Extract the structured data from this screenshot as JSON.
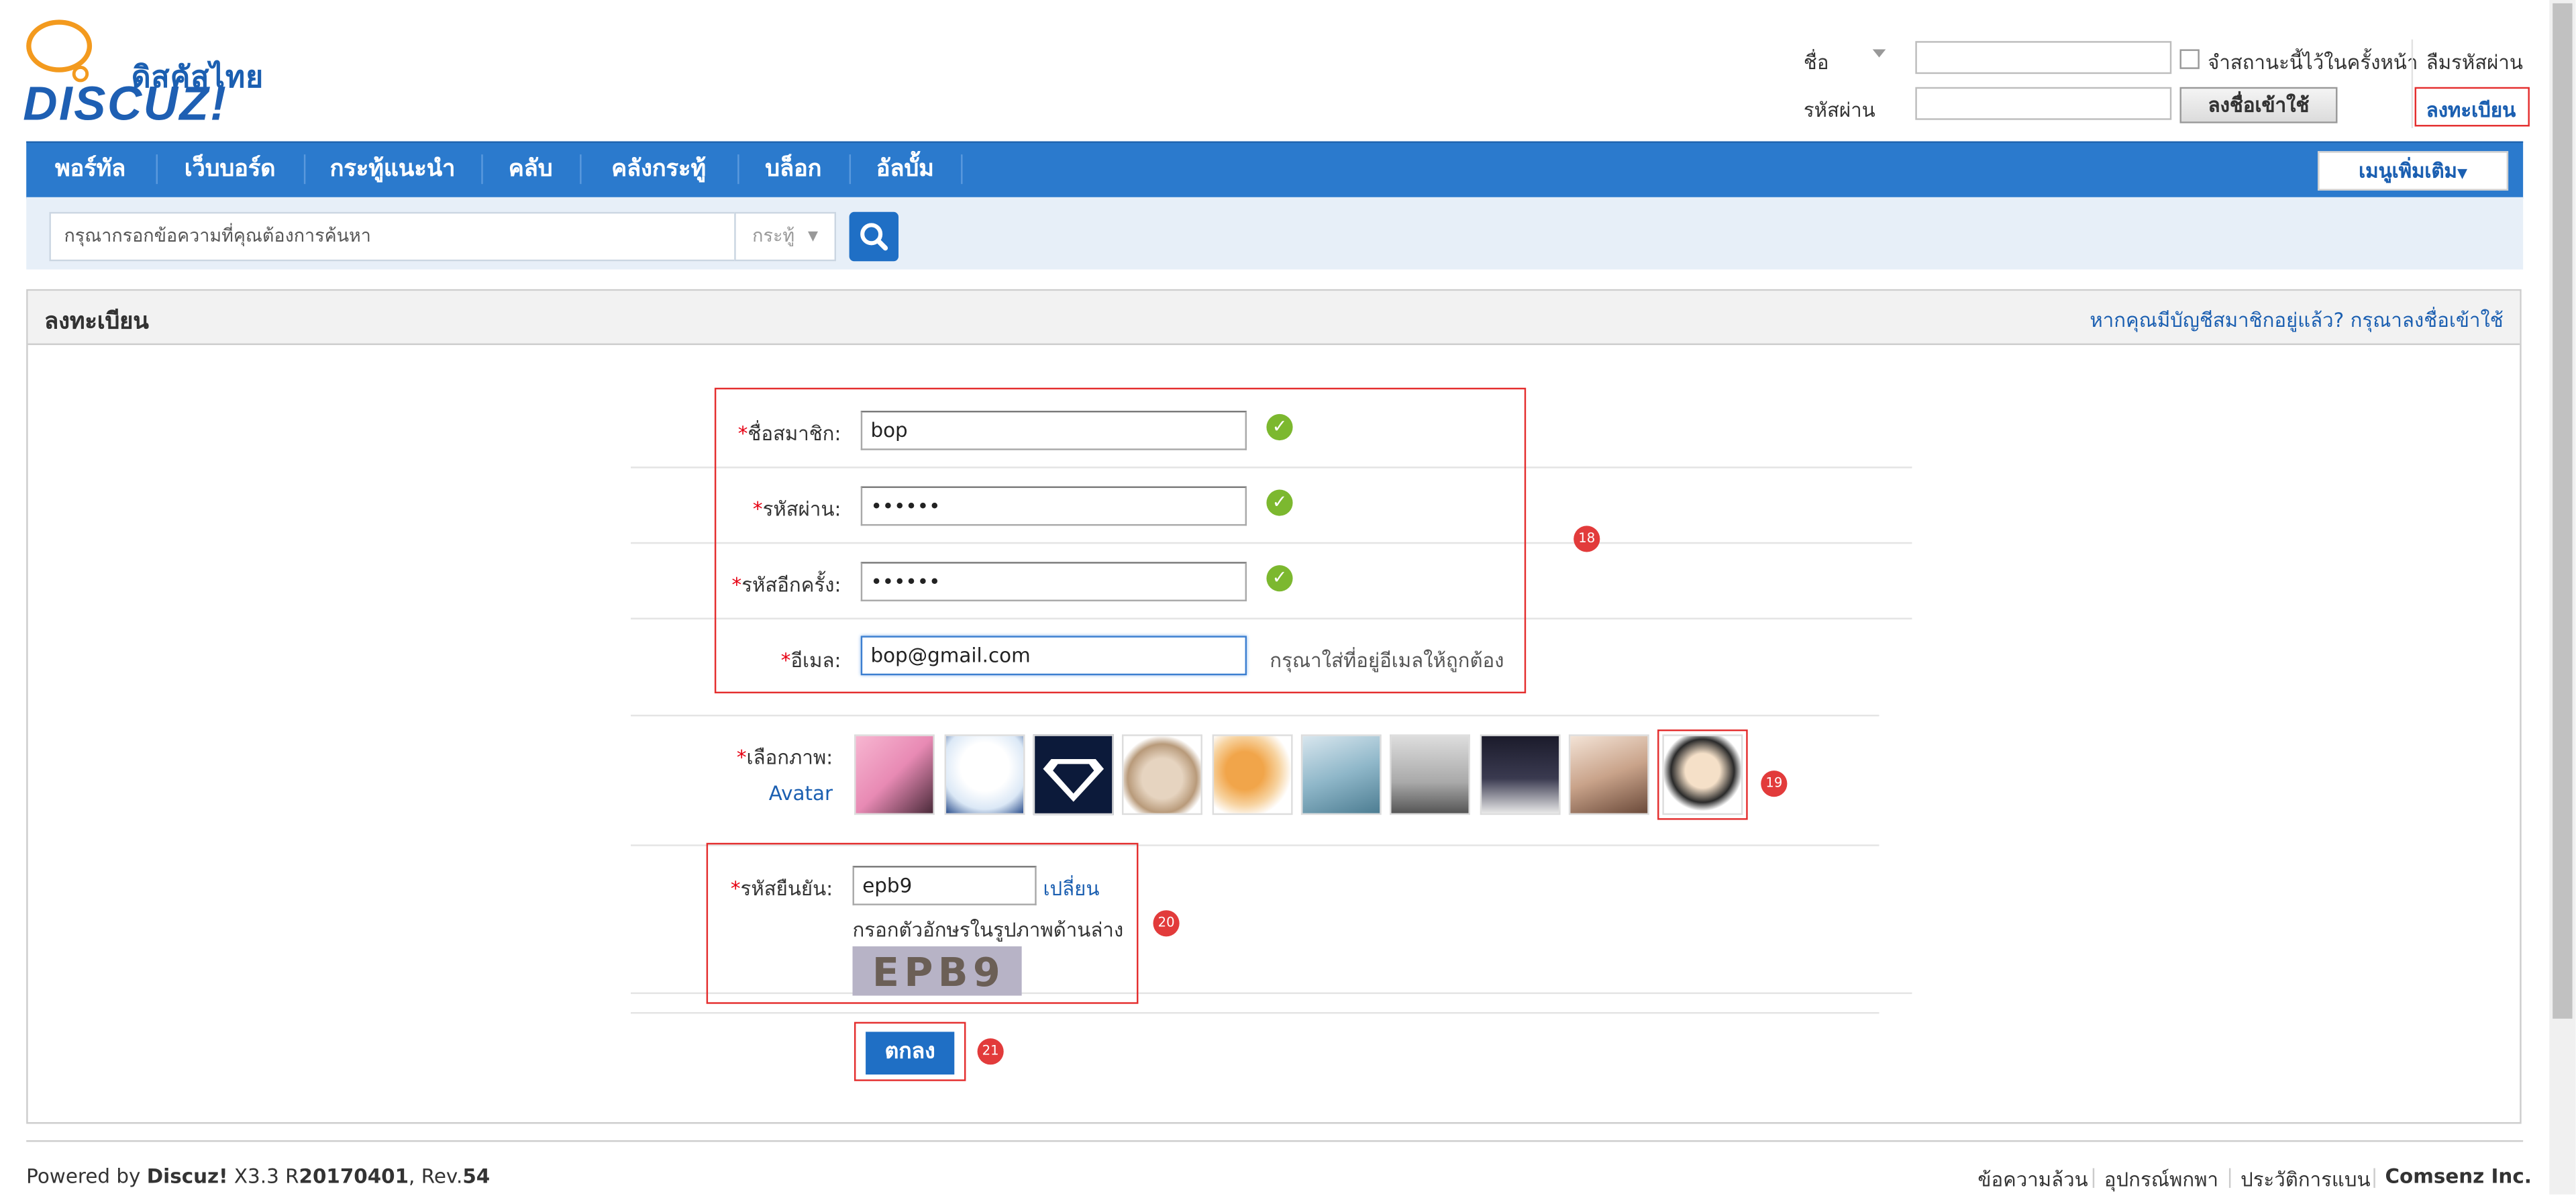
{
  "header": {
    "logo_thai": "ดิสคัสไทย",
    "logo_en": "DISCUZ!",
    "login": {
      "username_label": "ชื่อ",
      "password_label": "รหัสผ่าน",
      "remember_label": "จำสถานะนี้ไว้ในครั้งหน้า",
      "forgot_password": "ลืมรหัสผ่าน",
      "login_button": "ลงชื่อเข้าใช้",
      "register_link": "ลงทะเบียน"
    }
  },
  "nav": {
    "items": [
      "พอร์ทัล",
      "เว็บบอร์ด",
      "กระทู้แนะนำ",
      "คลับ",
      "คลังกระทู้",
      "บล็อก",
      "อัลบั้ม"
    ],
    "more": "เมนูเพิ่มเติม"
  },
  "search": {
    "placeholder": "กรุณากรอกข้อความที่คุณต้องการค้นหา",
    "type": "กระทู้"
  },
  "register": {
    "title": "ลงทะเบียน",
    "login_prompt": "หากคุณมีบัญชีสมาชิกอยู่แล้ว? กรุณาลงชื่อเข้าใช้",
    "fields": {
      "username": {
        "label": "ชื่อสมาชิก:",
        "value": "bop"
      },
      "password": {
        "label": "รหัสผ่าน:",
        "value": "••••••"
      },
      "password2": {
        "label": "รหัสอีกครั้ง:",
        "value": "••••••"
      },
      "email": {
        "label": "อีเมล:",
        "value": "bop@gmail.com",
        "hint": "กรุณาใส่ที่อยู่อีเมลให้ถูกต้อง"
      }
    },
    "avatar": {
      "label": "เลือกภาพ:",
      "sub": "Avatar"
    },
    "captcha": {
      "label": "รหัสยืนยัน:",
      "value": "epb9",
      "change": "เปลี่ยน",
      "hint": "กรอกตัวอักษรในรูปภาพด้านล่าง",
      "image_text": "EPB9"
    },
    "submit": "ตกลง",
    "required_mark": "*"
  },
  "annotations": [
    "18",
    "19",
    "20",
    "21"
  ],
  "footer": {
    "powered_prefix": "Powered by ",
    "brand": "Discuz!",
    "version": " X3.3 R",
    "rev_date": "20170401",
    "rev_label": ", Rev.",
    "rev_num": "54",
    "links": [
      "ข้อความล้วน",
      "อุปกรณ์พกพา",
      "ประวัติการแบน",
      "Comsenz Inc."
    ]
  },
  "colors": {
    "nav": "#2b7acd",
    "link": "#1b5fb1",
    "required": "#e60012",
    "annotation": "#e23b3b",
    "ok": "#7cb82f"
  }
}
